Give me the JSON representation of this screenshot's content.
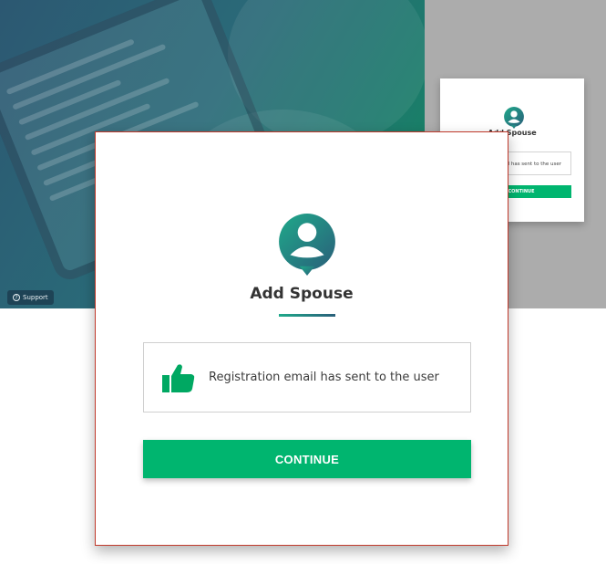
{
  "background": {
    "support_label": "Support",
    "colors": {
      "hero_start": "#2c5872",
      "hero_end": "#128a5e",
      "side_panel": "#acacac"
    }
  },
  "preview_dialog": {
    "title": "Add Spouse",
    "message": "email has sent to the user",
    "button_label": "CONTINUE"
  },
  "dialog": {
    "icon": "user-avatar-icon",
    "title": "Add Spouse",
    "message_icon": "thumbs-up-icon",
    "message": "Registration email has sent to the user",
    "button_label": "CONTINUE",
    "colors": {
      "accent": "#00b56f",
      "avatar": "#1a8a7a",
      "border": "#c0392b"
    }
  }
}
